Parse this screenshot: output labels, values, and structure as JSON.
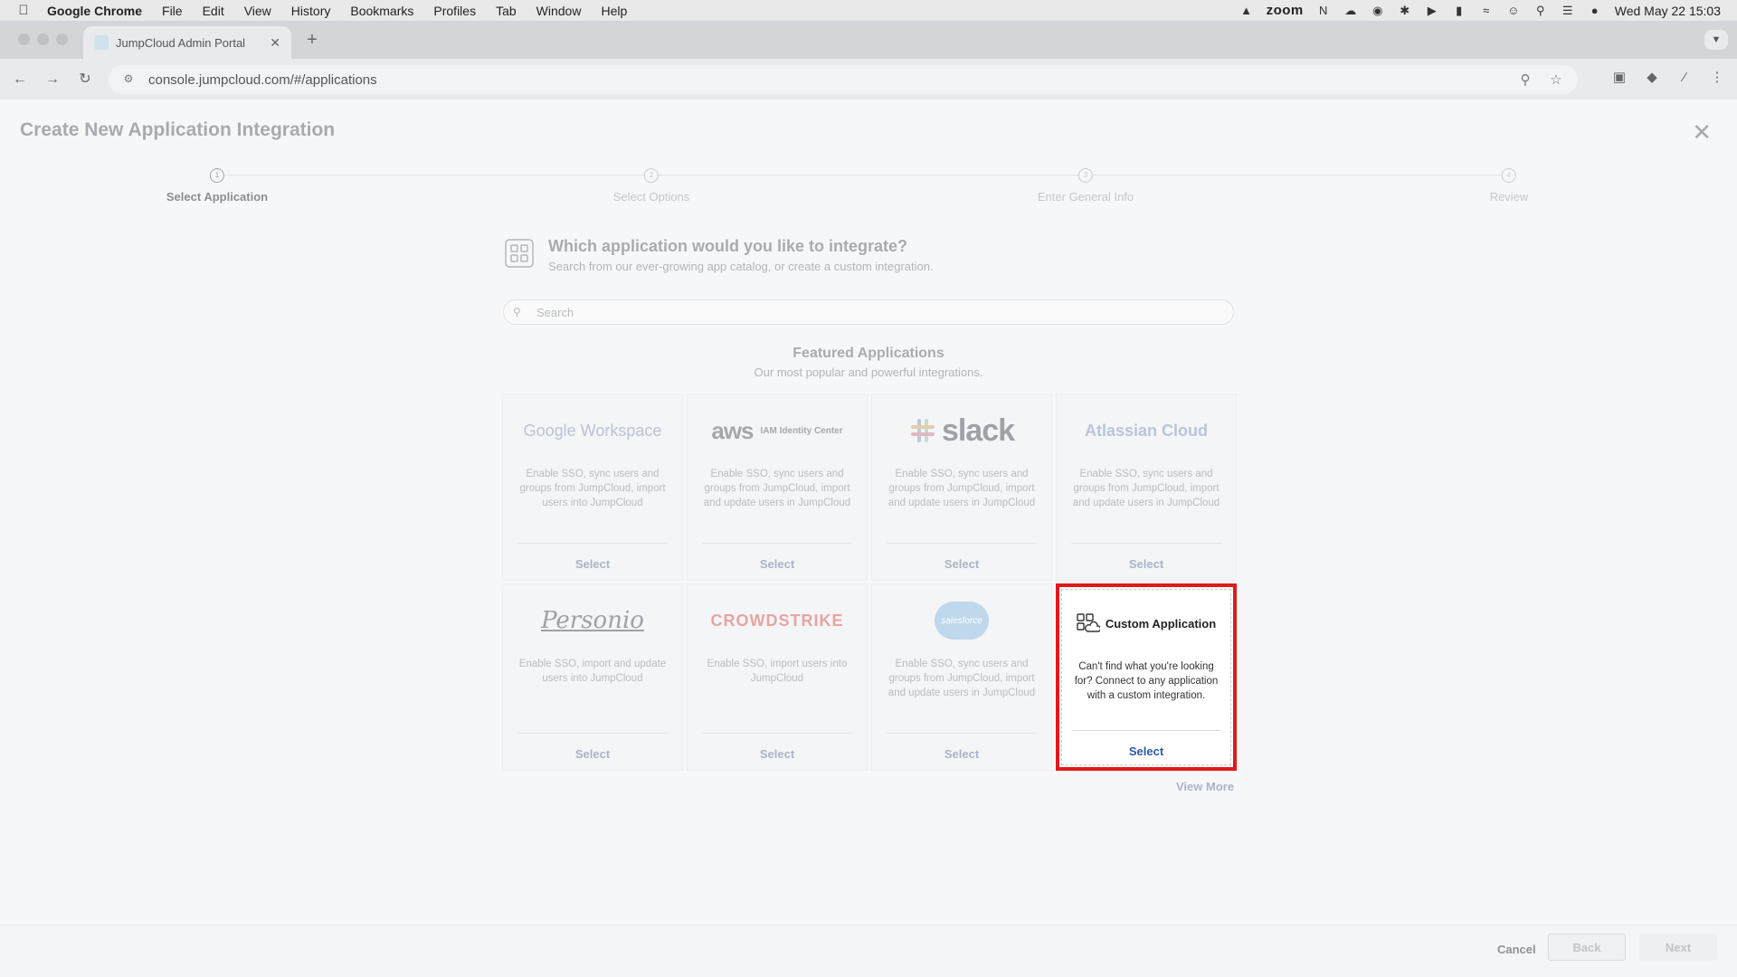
{
  "menubar": {
    "app_name": "Google Chrome",
    "items": [
      "File",
      "Edit",
      "View",
      "History",
      "Bookmarks",
      "Profiles",
      "Tab",
      "Window",
      "Help"
    ],
    "zoom_label": "zoom",
    "datetime": "Wed May 22  15:03"
  },
  "browser": {
    "tab_title": "JumpCloud Admin Portal",
    "url": "console.jumpcloud.com/#/applications"
  },
  "page": {
    "title": "Create New Application Integration",
    "steps": [
      "Select Application",
      "Select Options",
      "Enter General Info",
      "Review"
    ],
    "question_title": "Which application would you like to integrate?",
    "question_subtitle": "Search from our ever-growing app catalog, or create a custom integration.",
    "search_placeholder": "Search",
    "featured_title": "Featured Applications",
    "featured_subtitle": "Our most popular and powerful integrations.",
    "view_more": "View More"
  },
  "cards": [
    {
      "logo_text_1": "Google",
      "logo_text_2": " Workspace",
      "desc": "Enable SSO, sync users and groups from JumpCloud, import users into JumpCloud",
      "select": "Select"
    },
    {
      "logo_text_1": "aws",
      "logo_text_2": "IAM Identity Center",
      "desc": "Enable SSO, sync users and groups from JumpCloud, import and update users in JumpCloud",
      "select": "Select"
    },
    {
      "logo_text_1": "slack",
      "desc": "Enable SSO, sync users and groups from JumpCloud, import and update users in JumpCloud",
      "select": "Select"
    },
    {
      "logo_text_1": "Atlassian Cloud",
      "desc": "Enable SSO, sync users and groups from JumpCloud, import and update users in JumpCloud",
      "select": "Select"
    },
    {
      "logo_text_1": "Personio",
      "desc": "Enable SSO, import and update users into JumpCloud",
      "select": "Select"
    },
    {
      "logo_text_1": "CROWDSTRIKE",
      "desc": "Enable SSO, import users into JumpCloud",
      "select": "Select"
    },
    {
      "logo_text_1": "salesforce",
      "desc": "Enable SSO, sync users and groups from JumpCloud, import and update users in JumpCloud",
      "select": "Select"
    },
    {
      "logo_text_1": "Custom Application",
      "desc": "Can't find what you're looking for? Connect to any application with a custom integration.",
      "select": "Select"
    }
  ],
  "footer": {
    "cancel": "Cancel",
    "back": "Back",
    "next": "Next"
  },
  "colors": {
    "highlight_border": "#e0191b",
    "link_blue": "#2b5ba8"
  }
}
